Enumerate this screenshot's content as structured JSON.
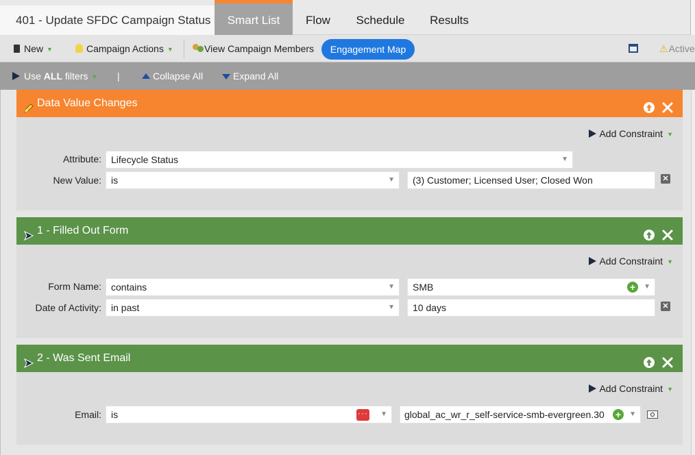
{
  "tabs": {
    "title": "401 - Update SFDC Campaign Status",
    "items": [
      "Smart List",
      "Flow",
      "Schedule",
      "Results"
    ]
  },
  "toolbar": {
    "new_label": "New",
    "campaign_actions_label": "Campaign Actions",
    "view_members_label": "View Campaign Members",
    "engagement_map_label": "Engagement Map",
    "active_label": "Active"
  },
  "filterbar": {
    "use_prefix": "Use",
    "use_all": "ALL",
    "use_suffix": "filters",
    "separator": "|",
    "collapse_label": "Collapse All",
    "expand_label": "Expand All"
  },
  "cards": [
    {
      "title": "Data Value Changes",
      "add_constraint": "Add Constraint",
      "rows": [
        {
          "label": "Attribute:",
          "operator": "Lifecycle Status"
        },
        {
          "label": "New Value:",
          "operator": "is",
          "value": "(3) Customer; Licensed User; Closed Won"
        }
      ]
    },
    {
      "title": "1 - Filled Out Form",
      "add_constraint": "Add Constraint",
      "rows": [
        {
          "label": "Form Name:",
          "operator": "contains",
          "value": "SMB"
        },
        {
          "label": "Date of Activity:",
          "operator": "in past",
          "value": "10 days"
        }
      ]
    },
    {
      "title": "2 - Was Sent Email",
      "add_constraint": "Add Constraint",
      "rows": [
        {
          "label": "Email:",
          "operator": "is",
          "value": "global_ac_wr_r_self-service-smb-evergreen.30"
        }
      ]
    }
  ],
  "colors": {
    "accent_orange": "#f7852f",
    "filter_green": "#5b9349",
    "pill_blue": "#1f78e0"
  }
}
